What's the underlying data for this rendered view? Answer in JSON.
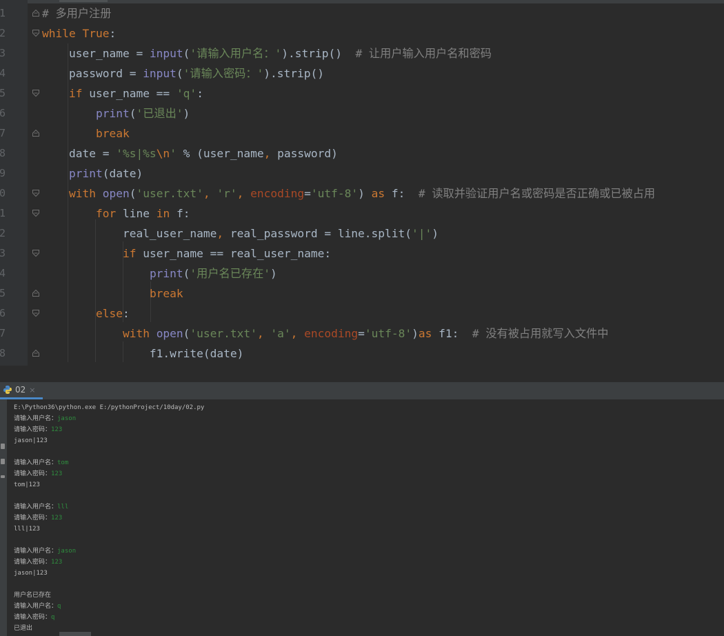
{
  "editor": {
    "line_numbers": [
      "1",
      "2",
      "3",
      "4",
      "5",
      "6",
      "7",
      "8",
      "9",
      "0",
      "1",
      "2",
      "3",
      "4",
      "5",
      "6",
      "7",
      "8"
    ],
    "lines": [
      [
        {
          "t": "# 多用户注册",
          "c": "cm"
        }
      ],
      [
        {
          "t": "while",
          "c": "kw"
        },
        {
          "t": " ",
          "c": ""
        },
        {
          "t": "True",
          "c": "kw"
        },
        {
          "t": ":",
          "c": ""
        }
      ],
      [
        {
          "t": "    user_name = ",
          "c": ""
        },
        {
          "t": "input",
          "c": "bi"
        },
        {
          "t": "(",
          "c": ""
        },
        {
          "t": "'请输入用户名：'",
          "c": "str"
        },
        {
          "t": ").strip()  ",
          "c": ""
        },
        {
          "t": "# 让用户输入用户名和密码",
          "c": "cm"
        }
      ],
      [
        {
          "t": "    password = ",
          "c": ""
        },
        {
          "t": "input",
          "c": "bi"
        },
        {
          "t": "(",
          "c": ""
        },
        {
          "t": "'请输入密码：'",
          "c": "str"
        },
        {
          "t": ").strip()",
          "c": ""
        }
      ],
      [
        {
          "t": "    ",
          "c": ""
        },
        {
          "t": "if",
          "c": "kw"
        },
        {
          "t": " user_name == ",
          "c": ""
        },
        {
          "t": "'q'",
          "c": "str"
        },
        {
          "t": ":",
          "c": ""
        }
      ],
      [
        {
          "t": "        ",
          "c": ""
        },
        {
          "t": "print",
          "c": "bi"
        },
        {
          "t": "(",
          "c": ""
        },
        {
          "t": "'已退出'",
          "c": "str"
        },
        {
          "t": ")",
          "c": ""
        }
      ],
      [
        {
          "t": "        ",
          "c": ""
        },
        {
          "t": "break",
          "c": "kw"
        }
      ],
      [
        {
          "t": "    date = ",
          "c": ""
        },
        {
          "t": "'%s|%s",
          "c": "str"
        },
        {
          "t": "\\n",
          "c": "esc"
        },
        {
          "t": "'",
          "c": "str"
        },
        {
          "t": " % (user_name",
          "c": ""
        },
        {
          "t": ",",
          "c": "kw"
        },
        {
          "t": " password)",
          "c": ""
        }
      ],
      [
        {
          "t": "    ",
          "c": ""
        },
        {
          "t": "print",
          "c": "bi"
        },
        {
          "t": "(date)",
          "c": ""
        }
      ],
      [
        {
          "t": "    ",
          "c": ""
        },
        {
          "t": "with",
          "c": "kw"
        },
        {
          "t": " ",
          "c": ""
        },
        {
          "t": "open",
          "c": "bi"
        },
        {
          "t": "(",
          "c": ""
        },
        {
          "t": "'user.txt'",
          "c": "str"
        },
        {
          "t": ",",
          "c": "kw"
        },
        {
          "t": " ",
          "c": ""
        },
        {
          "t": "'r'",
          "c": "str"
        },
        {
          "t": ",",
          "c": "kw"
        },
        {
          "t": " ",
          "c": ""
        },
        {
          "t": "encoding",
          "c": "kwa"
        },
        {
          "t": "=",
          "c": ""
        },
        {
          "t": "'utf-8'",
          "c": "str"
        },
        {
          "t": ") ",
          "c": ""
        },
        {
          "t": "as",
          "c": "kw"
        },
        {
          "t": " f:  ",
          "c": ""
        },
        {
          "t": "# 读取并验证用户名或密码是否正确或已被占用",
          "c": "cm"
        }
      ],
      [
        {
          "t": "        ",
          "c": ""
        },
        {
          "t": "for",
          "c": "kw"
        },
        {
          "t": " line ",
          "c": ""
        },
        {
          "t": "in",
          "c": "kw"
        },
        {
          "t": " f:",
          "c": ""
        }
      ],
      [
        {
          "t": "            real_user_name",
          "c": ""
        },
        {
          "t": ",",
          "c": "kw"
        },
        {
          "t": " real_password = line.split(",
          "c": ""
        },
        {
          "t": "'|'",
          "c": "str"
        },
        {
          "t": ")",
          "c": ""
        }
      ],
      [
        {
          "t": "            ",
          "c": ""
        },
        {
          "t": "if",
          "c": "kw"
        },
        {
          "t": " user_name == real_user_name:",
          "c": ""
        }
      ],
      [
        {
          "t": "                ",
          "c": ""
        },
        {
          "t": "print",
          "c": "bi"
        },
        {
          "t": "(",
          "c": ""
        },
        {
          "t": "'用户名已存在'",
          "c": "str"
        },
        {
          "t": ")",
          "c": ""
        }
      ],
      [
        {
          "t": "                ",
          "c": ""
        },
        {
          "t": "break",
          "c": "kw"
        }
      ],
      [
        {
          "t": "        ",
          "c": ""
        },
        {
          "t": "else",
          "c": "kw"
        },
        {
          "t": ":",
          "c": ""
        }
      ],
      [
        {
          "t": "            ",
          "c": ""
        },
        {
          "t": "with",
          "c": "kw"
        },
        {
          "t": " ",
          "c": ""
        },
        {
          "t": "open",
          "c": "bi"
        },
        {
          "t": "(",
          "c": ""
        },
        {
          "t": "'user.txt'",
          "c": "str"
        },
        {
          "t": ",",
          "c": "kw"
        },
        {
          "t": " ",
          "c": ""
        },
        {
          "t": "'a'",
          "c": "str"
        },
        {
          "t": ",",
          "c": "kw"
        },
        {
          "t": " ",
          "c": ""
        },
        {
          "t": "encoding",
          "c": "kwa"
        },
        {
          "t": "=",
          "c": ""
        },
        {
          "t": "'utf-8'",
          "c": "str"
        },
        {
          "t": ")",
          "c": ""
        },
        {
          "t": "as",
          "c": "kw"
        },
        {
          "t": " f1:  ",
          "c": ""
        },
        {
          "t": "# 没有被占用就写入文件中",
          "c": "cm"
        }
      ],
      [
        {
          "t": "                f1.write(date)",
          "c": ""
        }
      ]
    ]
  },
  "run_panel": {
    "tab_label": "02",
    "close_glyph": "×",
    "console_lines": [
      [
        {
          "t": "E:\\Python36\\python.exe E:/pythonProject/10day/02.py",
          "c": ""
        }
      ],
      [
        {
          "t": "请输入用户名：",
          "c": ""
        },
        {
          "t": "jason",
          "c": "in"
        }
      ],
      [
        {
          "t": "请输入密码：",
          "c": ""
        },
        {
          "t": "123",
          "c": "in"
        }
      ],
      [
        {
          "t": "jason|123",
          "c": ""
        }
      ],
      [],
      [
        {
          "t": "请输入用户名：",
          "c": ""
        },
        {
          "t": "tom",
          "c": "in"
        }
      ],
      [
        {
          "t": "请输入密码：",
          "c": ""
        },
        {
          "t": "123",
          "c": "in"
        }
      ],
      [
        {
          "t": "tom|123",
          "c": ""
        }
      ],
      [],
      [
        {
          "t": "请输入用户名：",
          "c": ""
        },
        {
          "t": "lll",
          "c": "in"
        }
      ],
      [
        {
          "t": "请输入密码：",
          "c": ""
        },
        {
          "t": "123",
          "c": "in"
        }
      ],
      [
        {
          "t": "lll|123",
          "c": ""
        }
      ],
      [],
      [
        {
          "t": "请输入用户名：",
          "c": ""
        },
        {
          "t": "jason",
          "c": "in"
        }
      ],
      [
        {
          "t": "请输入密码：",
          "c": ""
        },
        {
          "t": "123",
          "c": "in"
        }
      ],
      [
        {
          "t": "jason|123",
          "c": ""
        }
      ],
      [],
      [
        {
          "t": "用户名已存在",
          "c": ""
        }
      ],
      [
        {
          "t": "请输入用户名：",
          "c": ""
        },
        {
          "t": "q",
          "c": "in"
        }
      ],
      [
        {
          "t": "请输入密码：",
          "c": ""
        },
        {
          "t": "q",
          "c": "in"
        }
      ],
      [
        {
          "t": "已退出",
          "c": ""
        }
      ]
    ]
  },
  "colors": {
    "keyword": "#cc7832",
    "builtin": "#8888c6",
    "string": "#6a8759",
    "comment": "#808080",
    "kwarg": "#aa4926",
    "console_input": "#2f8f3f",
    "tab_accent": "#4a88c7"
  }
}
